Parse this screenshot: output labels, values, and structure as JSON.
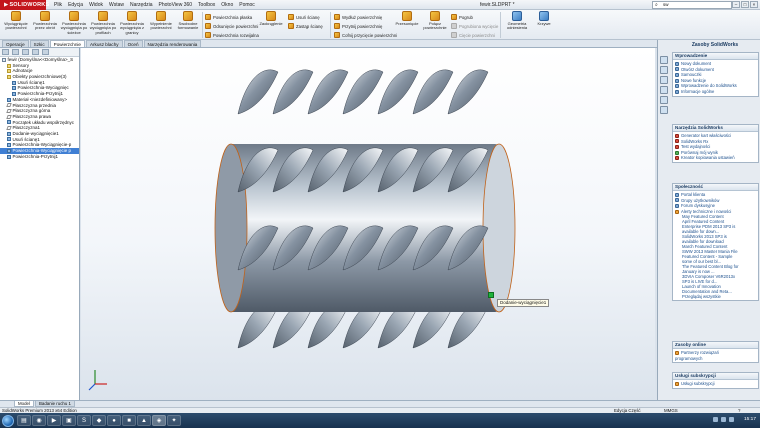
{
  "app": {
    "logo": "SOLIDWORKS",
    "document_title": "fewir.SLDPRT *",
    "search_placeholder": "sw"
  },
  "menu": [
    "Plik",
    "Edycja",
    "Widok",
    "Wstaw",
    "Narzędzia",
    "PhotoView 360",
    "Toolbox",
    "Okno",
    "Pomoc"
  ],
  "ribbon": {
    "big_buttons": [
      "Wyciągnięcie powierzchni",
      "Powierzchnia przez obrót",
      "Powierzchnia wyciągnięta po ścieżce",
      "Powierzchnia wyciągnięta po profilach",
      "Powierzchnia wyciągnięta z granicy",
      "Wypełnienie powierzchni",
      "Swobodne formowanie"
    ],
    "col1": [
      "Powierzchnia płaska",
      "Odsunięcie powierzchni",
      "Powierzchnia rozwijalna"
    ],
    "zaokraglenie": "Zaokrąglenie",
    "col2": [
      "Usuń ścianę",
      "Zastąp ścianę"
    ],
    "col3": [
      "Wydłuż powierzchnię",
      "Przytnij powierzchnię",
      "Cofnij przycięcie powierzchni"
    ],
    "przesuniecie": "Przesunięcie",
    "polacz": "Połącz powierzchnie",
    "col4": [
      "Pogrub",
      "Pogrubiona wycięcie",
      "Cięcie powierzchni"
    ],
    "geometria": "Geometria odniesienia",
    "krzywe": "Krzywe"
  },
  "tabs": [
    "Operacje",
    "Szkic",
    "Powierzchnie",
    "Arkusz blachy",
    "Oceń",
    "Narzędzia renderowania"
  ],
  "active_tab": "Powierzchnie",
  "tree": [
    {
      "label": "fewir (Domyślna<<Domyślna>_S",
      "icon": "part",
      "indent": 0
    },
    {
      "label": "Sensory",
      "icon": "fold",
      "indent": 1
    },
    {
      "label": "Adnotacje",
      "icon": "fold",
      "indent": 1
    },
    {
      "label": "Obiekty powierzchniowe(3)",
      "icon": "fold",
      "indent": 1
    },
    {
      "label": "Usuń ścianę1",
      "icon": "feat",
      "indent": 2
    },
    {
      "label": "Powierzchnia-Wyciągnięc",
      "icon": "feat",
      "indent": 2
    },
    {
      "label": "Powierzchnia-Przytnij1",
      "icon": "feat",
      "indent": 2
    },
    {
      "label": "Materiał <niezdefiniowany>",
      "icon": "feat",
      "indent": 1
    },
    {
      "label": "Płaszczyzna przednia",
      "icon": "plane",
      "indent": 1
    },
    {
      "label": "Płaszczyzna górna",
      "icon": "plane",
      "indent": 1
    },
    {
      "label": "Płaszczyzna prawa",
      "icon": "plane",
      "indent": 1
    },
    {
      "label": "Początek układu współrzędnyc",
      "icon": "feat",
      "indent": 1
    },
    {
      "label": "Płaszczyzna1",
      "icon": "plane",
      "indent": 1
    },
    {
      "label": "Dodanie-wyciągnięcie1",
      "icon": "feat",
      "indent": 1
    },
    {
      "label": "Usuń ścianę1",
      "icon": "feat",
      "indent": 1
    },
    {
      "label": "Powierzchnia-Wyciągnięcie-p",
      "icon": "feat",
      "indent": 1
    },
    {
      "label": "Powierzchnia-Wyciągnięcie p",
      "icon": "feat",
      "indent": 1,
      "selected": true
    },
    {
      "label": "Powierzchnia-Przytnij1",
      "icon": "feat",
      "indent": 1
    }
  ],
  "graphics": {
    "tooltip": "Dodanie-wyciągnięcie1"
  },
  "bottom_tabs": [
    "Model",
    "Badanie ruchu 1"
  ],
  "status": {
    "left": "SolidWorks Premium 2013 x64 Edition",
    "edit": "Edycja Część",
    "units": "MMGS",
    "help": "?"
  },
  "taskbar": {
    "clock": "15:17"
  },
  "task_pane": {
    "title": "Zasoby SolidWorks",
    "sections": [
      {
        "name": "Wprowadzenie",
        "items": [
          {
            "label": "Nowy dokument",
            "icon": "blue"
          },
          {
            "label": "Otwórz dokument",
            "icon": "blue"
          },
          {
            "label": "Samouczki",
            "icon": "blue"
          },
          {
            "label": "Nowe funkcje",
            "icon": "blue"
          },
          {
            "label": "Wprowadzenie do SolidWorks",
            "icon": "blue"
          },
          {
            "label": "Informacje ogólne",
            "icon": "blue"
          }
        ]
      },
      {
        "name": "Narzędzia SolidWorks",
        "items": [
          {
            "label": "Generator kart właściwości",
            "icon": "red"
          },
          {
            "label": "SolidWorks Rx",
            "icon": "red"
          },
          {
            "label": "Test wydajności",
            "icon": "red"
          },
          {
            "label": "Porównaj mój wynik",
            "icon": "grn"
          },
          {
            "label": "Kreator kopiowania ustawień",
            "icon": "red"
          }
        ]
      },
      {
        "name": "Społeczność",
        "items": [
          {
            "label": "Portal klienta",
            "icon": "blue"
          },
          {
            "label": "Grupy użytkowników",
            "icon": "blue"
          },
          {
            "label": "Forum dyskusyjne",
            "icon": "blue"
          },
          {
            "label": "Alerty techniczne i nowości",
            "icon": "org"
          },
          {
            "label": "May Featured Content",
            "sub": true
          },
          {
            "label": "April Featured Content",
            "sub": true
          },
          {
            "label": "Enterprise PDM 2013 SP3 is",
            "sub": true
          },
          {
            "label": "available for down...",
            "sub": true
          },
          {
            "label": "SolidWorks 2013 SP3 is",
            "sub": true
          },
          {
            "label": "available for download",
            "sub": true
          },
          {
            "label": "March Featured Content",
            "sub": true
          },
          {
            "label": "SWW 2013 Master Mania File",
            "sub": true
          },
          {
            "label": "Featured Content - Sample",
            "sub": true
          },
          {
            "label": "some of our best bl...",
            "sub": true
          },
          {
            "label": "The Featured Content Blog for",
            "sub": true
          },
          {
            "label": "January is now ...",
            "sub": true
          },
          {
            "label": "3DVIA Composer V6R2013x",
            "sub": true
          },
          {
            "label": "SP3 is LIVE for d...",
            "sub": true
          },
          {
            "label": "Launch of Innovation",
            "sub": true
          },
          {
            "label": "Documentation and Reta...",
            "sub": true
          },
          {
            "label": "Przeglądaj wszystkie",
            "sub": true
          }
        ]
      },
      {
        "name": "Zasoby online",
        "items": [
          {
            "label": "Partnerzy rozwiązań",
            "icon": "org"
          },
          {
            "label": "programowych",
            "icon": "none"
          }
        ]
      },
      {
        "name": "Usługi subskrypcji",
        "items": [
          {
            "label": "Usługi subskrypcji",
            "icon": "org"
          }
        ]
      }
    ]
  }
}
